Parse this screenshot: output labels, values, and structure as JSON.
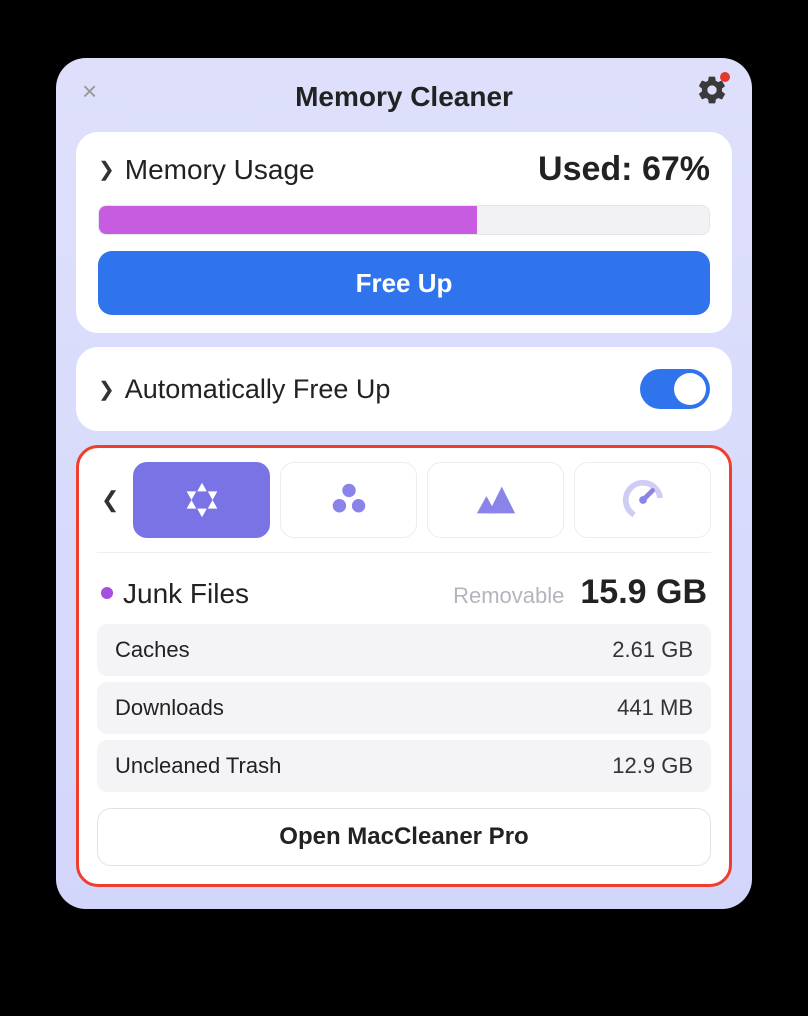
{
  "title": "Memory Cleaner",
  "memory": {
    "label": "Memory Usage",
    "used_label": "Used: 67%",
    "used_percent": 62,
    "free_up_label": "Free Up"
  },
  "auto": {
    "label": "Automatically Free Up",
    "enabled": true
  },
  "tabs": {
    "active_index": 0
  },
  "junk": {
    "dot_color": "#a74fe0",
    "title": "Junk Files",
    "removable_label": "Removable",
    "total": "15.9 GB",
    "items": [
      {
        "name": "Caches",
        "size": "2.61 GB"
      },
      {
        "name": "Downloads",
        "size": "441 MB"
      },
      {
        "name": "Uncleaned Trash",
        "size": "12.9 GB"
      }
    ]
  },
  "open_button": "Open MacCleaner Pro"
}
